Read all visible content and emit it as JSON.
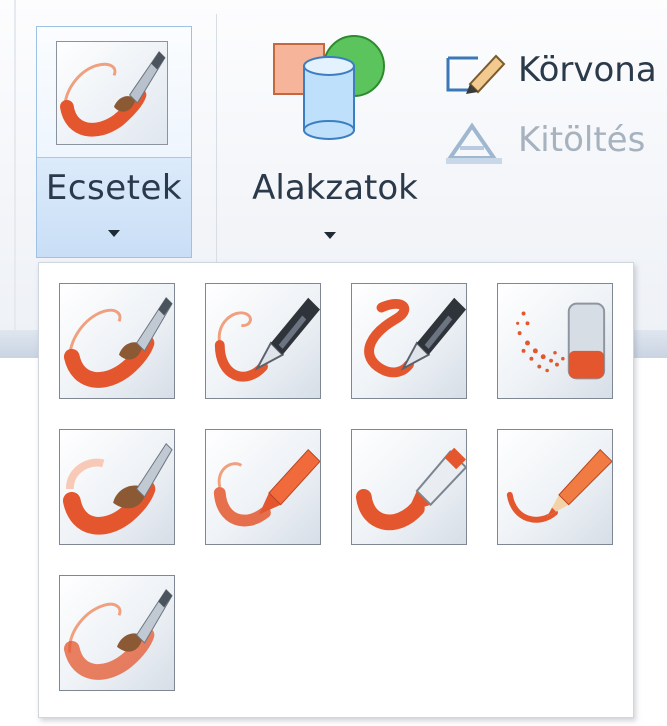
{
  "ribbon": {
    "brushes": {
      "label": "Ecsetek"
    },
    "shapes": {
      "label": "Alakzatok"
    },
    "outline": {
      "label": "Körvona"
    },
    "fill": {
      "label": "Kitöltés"
    }
  },
  "brush_gallery": {
    "items": [
      {
        "icon": "brush-icon"
      },
      {
        "icon": "calligraphy-pen-1-icon"
      },
      {
        "icon": "calligraphy-pen-2-icon"
      },
      {
        "icon": "airbrush-icon"
      },
      {
        "icon": "oil-brush-icon"
      },
      {
        "icon": "crayon-icon"
      },
      {
        "icon": "marker-icon"
      },
      {
        "icon": "natural-pencil-icon"
      },
      {
        "icon": "watercolor-brush-icon"
      }
    ]
  },
  "colors": {
    "stroke": "#e4572e",
    "accent": "#dcebfb",
    "border": "#9ec2e6"
  }
}
